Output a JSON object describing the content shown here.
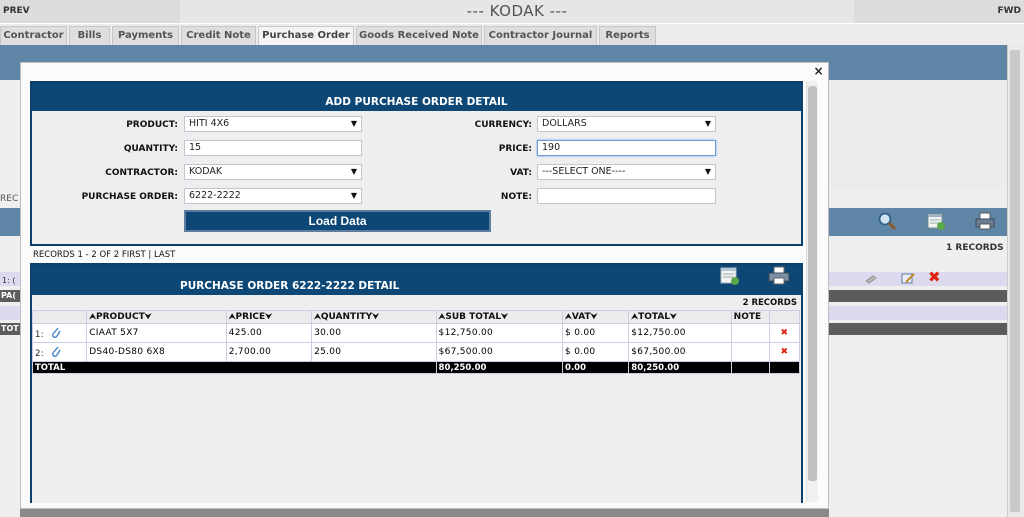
{
  "topbar": {
    "prev": "PREV",
    "title": "--- KODAK ---",
    "fwd": "FWD"
  },
  "tabs": [
    {
      "label": "Contractor",
      "active": false
    },
    {
      "label": "Bills",
      "active": false
    },
    {
      "label": "Payments",
      "active": false
    },
    {
      "label": "Credit Note",
      "active": false
    },
    {
      "label": "Purchase Order",
      "active": true
    },
    {
      "label": "Goods Received Note",
      "active": false
    },
    {
      "label": "Contractor Journal",
      "active": false
    },
    {
      "label": "Reports",
      "active": false
    }
  ],
  "background": {
    "records": "1 RECORDS",
    "frag_rec": "REC",
    "frag_row": "1: (",
    "frag_pa": "PA(",
    "frag_tot": "TOT"
  },
  "modal": {
    "close": "×",
    "add_panel": {
      "title": "ADD PURCHASE ORDER DETAIL",
      "fields": {
        "product": {
          "label": "PRODUCT:",
          "value": "HITI 4X6"
        },
        "quantity": {
          "label": "QUANTITY:",
          "value": "15"
        },
        "contractor": {
          "label": "CONTRACTOR:",
          "value": "KODAK"
        },
        "purchase_order": {
          "label": "PURCHASE ORDER:",
          "value": "6222-2222"
        },
        "currency": {
          "label": "CURRENCY:",
          "value": "DOLLARS"
        },
        "price": {
          "label": "PRICE:",
          "value": "190"
        },
        "vat": {
          "label": "VAT:",
          "value": "---SELECT ONE----"
        },
        "note": {
          "label": "NOTE:",
          "value": ""
        }
      },
      "load_button": "Load Data"
    },
    "records_line": "RECORDS 1 - 2 OF 2 FIRST | LAST",
    "po_panel": {
      "title": "PURCHASE ORDER 6222-2222 DETAIL",
      "records": "2 RECORDS",
      "columns": [
        "PRODUCT",
        "PRICE",
        "QUANTITY",
        "SUB TOTAL",
        "VAT",
        "TOTAL",
        "NOTE"
      ],
      "rows": [
        {
          "no": "1:",
          "product": "CIAAT 5X7",
          "price": "425.00",
          "quantity": "30.00",
          "subtotal": "$12,750.00",
          "vat": "$ 0.00",
          "total": "$12,750.00",
          "note": ""
        },
        {
          "no": "2:",
          "product": "DS40-DS80 6X8",
          "price": "2,700.00",
          "quantity": "25.00",
          "subtotal": "$67,500.00",
          "vat": "$ 0.00",
          "total": "$67,500.00",
          "note": ""
        }
      ],
      "total_row": {
        "label": "TOTAL",
        "subtotal": "80,250.00",
        "vat": "0.00",
        "total": "80,250.00"
      }
    }
  },
  "icons": [
    "search-icon",
    "export-icon",
    "print-icon",
    "attachment-icon",
    "delete-icon",
    "edit-icon"
  ],
  "colors": {
    "panel_header": "#0c4776",
    "background_header": "#5f86a7",
    "delete": "#e0240f"
  }
}
